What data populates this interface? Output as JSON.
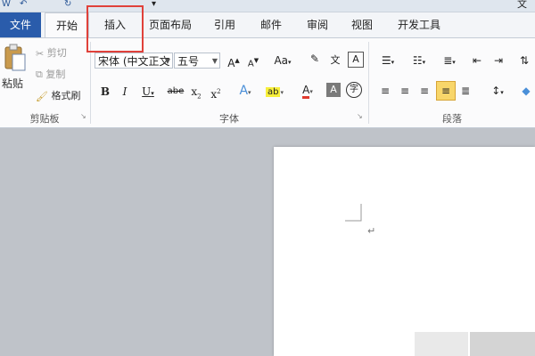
{
  "title_fragment": "文",
  "tabs": {
    "file": "文件",
    "home": "开始",
    "insert": "插入",
    "page_layout": "页面布局",
    "references": "引用",
    "mailings": "邮件",
    "review": "审阅",
    "view": "视图",
    "developer": "开发工具"
  },
  "clipboard": {
    "paste": "粘贴",
    "cut": "剪切",
    "copy": "复制",
    "format_painter": "格式刷",
    "label": "剪贴板"
  },
  "font": {
    "font_name": "宋体 (中文正文",
    "font_size": "五号",
    "label": "字体",
    "grow": "A",
    "shrink": "A",
    "case": "Aa",
    "phonetic": "文",
    "bold": "B",
    "italic": "I",
    "underline": "U",
    "strike": "abe",
    "subscript": "x",
    "font_color": "A",
    "char_shading": "A",
    "enclose": "字"
  },
  "paragraph": {
    "label": "段落"
  },
  "document": {
    "paragraph_mark": "↵"
  },
  "colors": {
    "file_tab": "#2a5cab",
    "highlight_border": "#e0413a",
    "ribbon_bg": "#fbfbfc",
    "workspace_bg": "#bfc3c9"
  }
}
